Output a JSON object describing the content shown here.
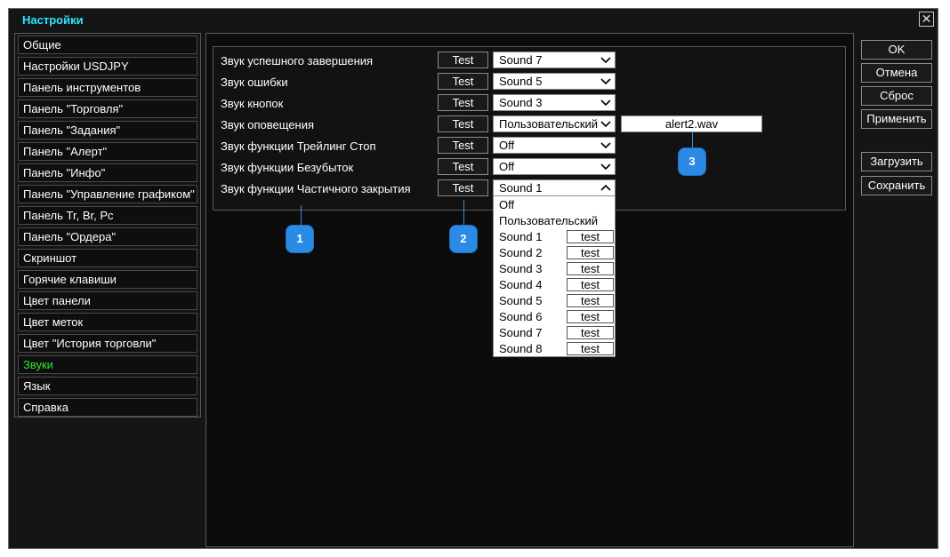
{
  "window": {
    "title": "Настройки"
  },
  "sidebar": {
    "items": [
      {
        "label": "Общие"
      },
      {
        "label": "Настройки USDJPY"
      },
      {
        "label": "Панель инструментов"
      },
      {
        "label": "Панель \"Торговля\""
      },
      {
        "label": "Панель \"Задания\""
      },
      {
        "label": "Панель \"Алерт\""
      },
      {
        "label": "Панель \"Инфо\""
      },
      {
        "label": "Панель \"Управление графиком\""
      },
      {
        "label": "Панель Tr, Br, Pc"
      },
      {
        "label": "Панель \"Ордера\""
      },
      {
        "label": "Скриншот"
      },
      {
        "label": "Горячие клавиши"
      },
      {
        "label": "Цвет панели"
      },
      {
        "label": "Цвет меток"
      },
      {
        "label": "Цвет \"История торговли\""
      },
      {
        "label": "Звуки"
      },
      {
        "label": "Язык"
      },
      {
        "label": "Справка"
      }
    ],
    "active": "Звуки",
    "active_color": "#2fe62f"
  },
  "sounds": {
    "test_label": "Test",
    "rows": [
      {
        "label": "Звук успешного завершения",
        "value": "Sound 7"
      },
      {
        "label": "Звук ошибки",
        "value": "Sound 5"
      },
      {
        "label": "Звук кнопок",
        "value": "Sound 3"
      },
      {
        "label": "Звук оповещения",
        "value": "Пользовательский"
      },
      {
        "label": "Звук функции Трейлинг Стоп",
        "value": "Off"
      },
      {
        "label": "Звук функции Безубыток",
        "value": "Off"
      },
      {
        "label": "Звук функции Частичного закрытия",
        "value": "Sound 1"
      }
    ],
    "custom_file": "alert2.wav"
  },
  "dropdown": {
    "test_label": "test",
    "options": [
      "Off",
      "Пользовательский",
      "Sound 1",
      "Sound 2",
      "Sound 3",
      "Sound 4",
      "Sound 5",
      "Sound 6",
      "Sound 7",
      "Sound 8"
    ]
  },
  "buttons": {
    "ok": "OK",
    "cancel": "Отмена",
    "reset": "Сброс",
    "apply": "Применить",
    "load": "Загрузить",
    "save": "Сохранить"
  },
  "callouts": [
    "1",
    "2",
    "3"
  ],
  "colors": {
    "title": "#2ee6ff",
    "callout": "#2b8ae4"
  }
}
